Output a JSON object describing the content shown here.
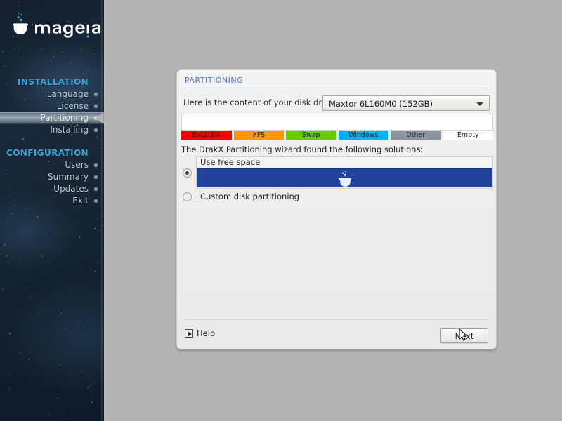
{
  "branding": {
    "logo_text": "mageia",
    "logo_icon": "mageia-drop-logo"
  },
  "sidebar": {
    "sections": [
      {
        "heading": "INSTALLATION",
        "items": [
          {
            "label": "Language",
            "active": false
          },
          {
            "label": "License",
            "active": false
          },
          {
            "label": "Partitioning",
            "active": true
          },
          {
            "label": "Installing",
            "active": false
          }
        ]
      },
      {
        "heading": "CONFIGURATION",
        "items": [
          {
            "label": "Users",
            "active": false
          },
          {
            "label": "Summary",
            "active": false
          },
          {
            "label": "Updates",
            "active": false
          },
          {
            "label": "Exit",
            "active": false
          }
        ]
      }
    ]
  },
  "dialog": {
    "title": "PARTITIONING",
    "drive": {
      "label": "Here is the content of your disk drive",
      "selected": "Maxtor 6L160M0 (152GB)",
      "dropdown_icon": "chevron-down-icon"
    },
    "legend": [
      {
        "label": "Ext2/3/4",
        "color": "#fa0000",
        "text_color": "#1f1f1f"
      },
      {
        "label": "XFS",
        "color": "#ff9900",
        "text_color": "#1f1f1f"
      },
      {
        "label": "Swap",
        "color": "#66cc00",
        "text_color": "#1f1f1f"
      },
      {
        "label": "Windows",
        "color": "#00b0f0",
        "text_color": "#1f1f1f"
      },
      {
        "label": "Other",
        "color": "#8c94a0",
        "text_color": "#1f1f1f"
      },
      {
        "label": "Empty",
        "color": "#ffffff",
        "text_color": "#1f1f1f"
      }
    ],
    "disk_map": {
      "segments": [
        {
          "label": "Empty",
          "color": "#ffffff",
          "percent": 100
        }
      ]
    },
    "solutions_label": "The DrakX Partitioning wizard found the following solutions:",
    "options": [
      {
        "label": "Use free space",
        "selected": true,
        "bar_color": "#22429b",
        "bar_icon": "mageia-logo-icon"
      },
      {
        "label": "Custom disk partitioning",
        "selected": false
      }
    ],
    "footer": {
      "help_label": "Help",
      "help_icon": "play-box-icon",
      "next_label": "Next"
    }
  },
  "cursor": {
    "icon": "arrow-pointer-icon"
  },
  "colors": {
    "desktop_background": "#b4b4b4",
    "dialog_background": "#efeeec",
    "title_accent": "#5577bb",
    "sidebar_heading": "#3ba4dd",
    "selection_blue": "#22429b"
  }
}
